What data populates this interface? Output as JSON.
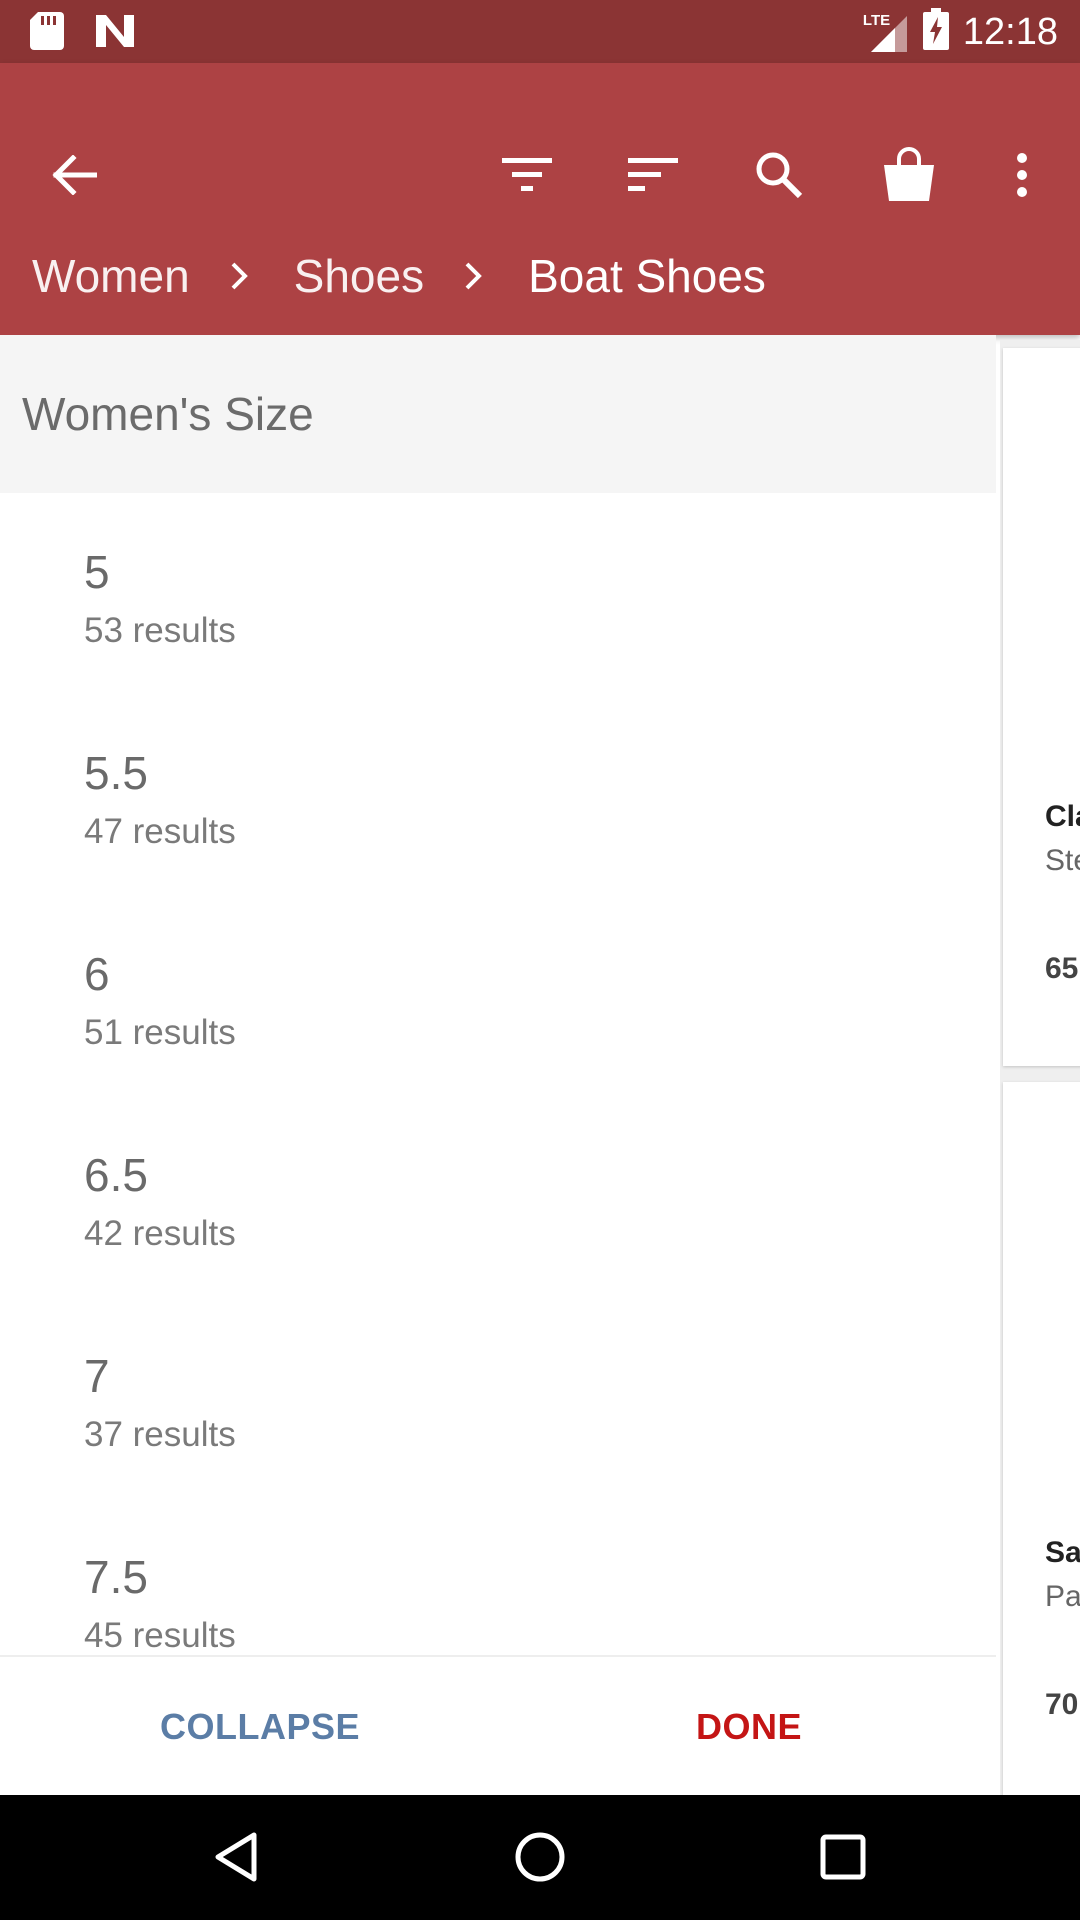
{
  "status_bar": {
    "time": "12:18",
    "network": "LTE",
    "icons": [
      "sd-card-icon",
      "n-notification-icon",
      "signal-icon",
      "battery-charging-icon"
    ]
  },
  "app_bar": {
    "icons": [
      "back-arrow-icon",
      "filter-icon",
      "sort-icon",
      "search-icon",
      "shopping-bag-icon",
      "more-vert-icon"
    ]
  },
  "breadcrumb": {
    "items": [
      "Women",
      "Shoes",
      "Boat Shoes"
    ]
  },
  "filter_panel": {
    "title": "Women's Size",
    "sizes": [
      {
        "size": "5",
        "count": "53 results"
      },
      {
        "size": "5.5",
        "count": "47 results"
      },
      {
        "size": "6",
        "count": "51 results"
      },
      {
        "size": "6.5",
        "count": "42 results"
      },
      {
        "size": "7",
        "count": "37 results"
      },
      {
        "size": "7.5",
        "count": "45 results"
      }
    ],
    "collapse_label": "COLLAPSE",
    "done_label": "DONE"
  },
  "products": [
    {
      "title": "Cla",
      "brand": "Ste",
      "price": "65"
    },
    {
      "title": "Sa",
      "brand": "Pa",
      "price": "70"
    }
  ],
  "colors": {
    "status_bar": "#8b3434",
    "app_bar": "#ad4244",
    "collapse": "#5b7da6",
    "done": "#c41515"
  }
}
